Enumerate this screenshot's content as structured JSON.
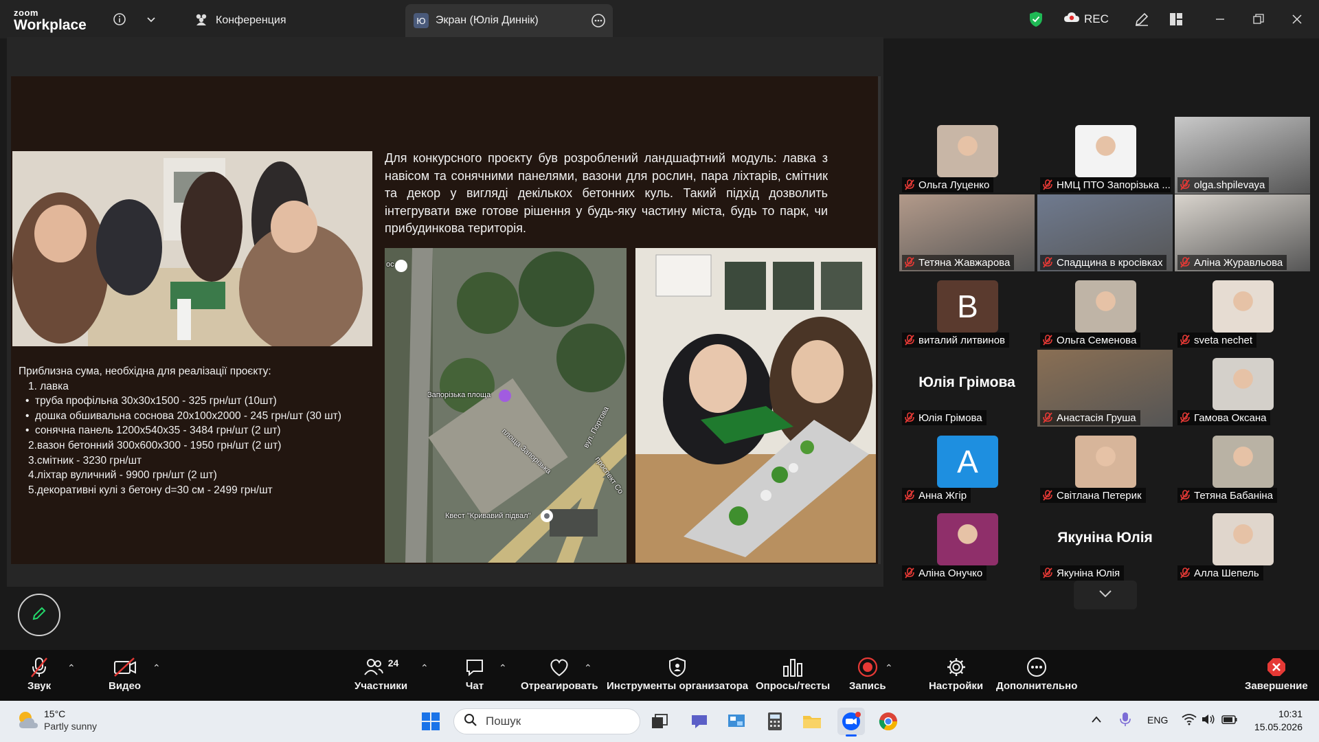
{
  "app": {
    "logo_top": "zoom",
    "logo_bottom": "Workplace"
  },
  "tabs": [
    {
      "label": "Конференция"
    },
    {
      "label": "Экран (Юлія Диннік)",
      "badge": "Ю"
    }
  ],
  "titlebar": {
    "rec_label": "REC"
  },
  "slide": {
    "description": "Для конкурсного проєкту був розроблений ландшафтний модуль: лавка з навісом та сонячними панелями, вазони для рослин, пара ліхтарів, смітник та декор у вигляді декількох бетонних куль. Такий підхід дозволить інтегрувати вже готове рішення у будь-яку частину міста, будь то парк, чи прибудинкова територія.",
    "budget_title": "Приблизна сума, необхідна для реалізації проєкту:",
    "budget_items": [
      "1. лавка",
      "труба профільна 30х30х1500 - 325 грн/шт (10шт)",
      "дошка обшивальна соснова 20х100х2000 - 245 грн/шт (30 шт)",
      "сонячна панель 1200х540х35 - 3484 грн/шт (2 шт)",
      "2.вазон бетонний 300х600х300 - 1950 грн/шт (2 шт)",
      "3.смітник - 3230 грн/шт",
      "4.ліхтар вуличний - 9900 грн/шт (2 шт)",
      "5.декоративні кулі з бетону  d=30 см - 2499 грн/шт"
    ],
    "map_labels": [
      "Запорізька площа",
      "площа Запорізька",
      "вул. Портова",
      "проспект Со",
      "Квест \"Кривавий підвал\"",
      "ос"
    ]
  },
  "participants": [
    {
      "name": "Ольга Луценко",
      "kind": "thumb",
      "color": "#c8b6a6"
    },
    {
      "name": "НМЦ ПТО Запорізька ...",
      "kind": "thumb",
      "color": "#f3f3f3"
    },
    {
      "name": "olga.shpilevaya",
      "kind": "full",
      "color": "#c9c9c9"
    },
    {
      "name": "Тетяна Жавжарова",
      "kind": "full",
      "color": "#b39a8a"
    },
    {
      "name": "Спадщина в кросівках",
      "kind": "full",
      "color": "#6f7a8f"
    },
    {
      "name": "Аліна Журавльова",
      "kind": "full",
      "color": "#d9d4cd",
      "speaking": true
    },
    {
      "name": "виталий литвинов",
      "kind": "letter",
      "letter": "В",
      "color": "#5a3a2e"
    },
    {
      "name": "Ольга Семенова",
      "kind": "thumb",
      "color": "#bfb4a6"
    },
    {
      "name": "sveta nechet",
      "kind": "thumb",
      "color": "#e6dcd2"
    },
    {
      "name": "Юлія Грімова",
      "kind": "text",
      "display": "Юлія Грімова"
    },
    {
      "name": "Анастасія Груша",
      "kind": "full",
      "color": "#8a6f54"
    },
    {
      "name": "Гамова Оксана",
      "kind": "thumb",
      "color": "#d4d0ca"
    },
    {
      "name": "Анна Жгір",
      "kind": "letter",
      "letter": "А",
      "color": "#1e8fe0"
    },
    {
      "name": "Світлана Петерик",
      "kind": "thumb",
      "color": "#d7b59a"
    },
    {
      "name": "Тетяна Бабаніна",
      "kind": "thumb",
      "color": "#b9b2a4"
    },
    {
      "name": "Аліна Онучко",
      "kind": "thumb",
      "color": "#8f2f6a"
    },
    {
      "name": "Якуніна Юлія",
      "kind": "text",
      "display": "Якуніна Юлія"
    },
    {
      "name": "Алла Шепель",
      "kind": "thumb",
      "color": "#e0d6cc"
    }
  ],
  "toolbar": {
    "audio": "Звук",
    "video": "Видео",
    "participants": "Участники",
    "participants_count": "24",
    "chat": "Чат",
    "react": "Отреагировать",
    "host_tools": "Инструменты организатора",
    "polls": "Опросы/тесты",
    "record": "Запись",
    "settings": "Настройки",
    "more": "Дополнительно",
    "end": "Завершение"
  },
  "taskbar": {
    "weather_temp": "15°C",
    "weather_desc": "Partly sunny",
    "search_placeholder": "Пошук",
    "lang": "ENG",
    "time": "10:31",
    "date": "15.05.2026"
  },
  "colors": {
    "accent_green": "#23d96b",
    "record_red": "#e02b2b",
    "zoom_blue": "#0b5cff"
  }
}
